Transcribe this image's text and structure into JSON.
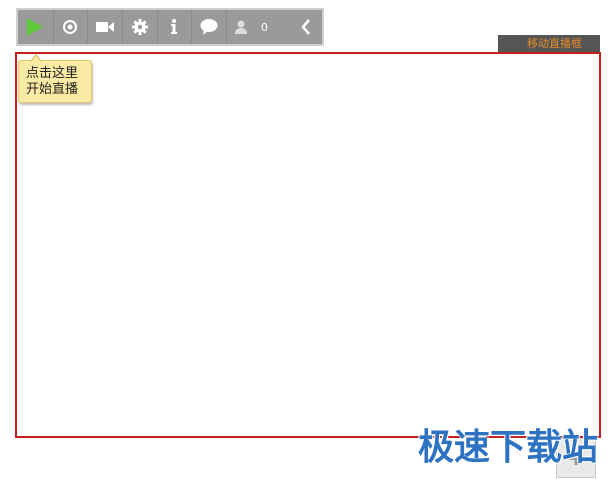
{
  "toolbar": {
    "buttons": [
      {
        "name": "play-icon",
        "title": "start"
      },
      {
        "name": "record-icon",
        "title": "record"
      },
      {
        "name": "camera-icon",
        "title": "camera"
      },
      {
        "name": "gear-icon",
        "title": "settings"
      },
      {
        "name": "info-icon",
        "title": "info"
      },
      {
        "name": "chat-icon",
        "title": "chat"
      }
    ],
    "viewer_icon": "user-icon",
    "viewer_count": "0",
    "collapse_icon": "chevron-left-icon",
    "play_color": "#5cc83a",
    "icon_color": "#ffffff"
  },
  "tooltip": {
    "line1": "点击这里",
    "line2": "开始直播"
  },
  "move_label": "移动直播框",
  "frame_border_color": "#c42020",
  "watermark": "极速下载站",
  "corner_icon": "resize-icon"
}
